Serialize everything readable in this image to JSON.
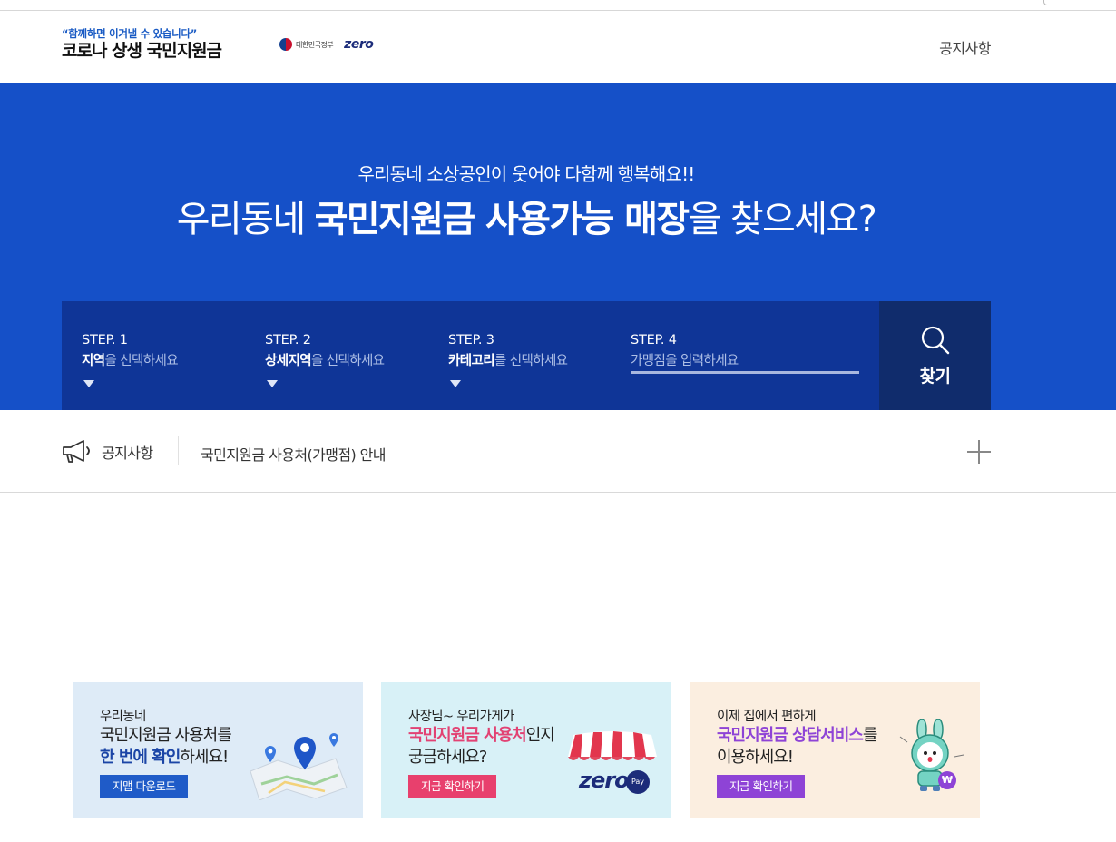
{
  "header": {
    "slogan": "“함께하면 이겨낼 수 있습니다”",
    "brand": "코로나 상생 국민지원금",
    "gov_name": "대한민국정부",
    "zero_logo": "zero",
    "notice_link": "공지사항"
  },
  "hero": {
    "subtitle": "우리동네 소상공인이 웃어야 다함께 행복해요!!",
    "title_pre": "우리동네 ",
    "title_bold": "국민지원금 사용가능 매장",
    "title_post": "을 찾으세요?",
    "accent_color": "#1550c8"
  },
  "search": {
    "steps": [
      {
        "no": "STEP. 1",
        "bold": "지역",
        "rest": "을 선택하세요"
      },
      {
        "no": "STEP. 2",
        "bold": "상세지역",
        "rest": "을 선택하세요"
      },
      {
        "no": "STEP. 3",
        "bold": "카테고리",
        "rest": "를 선택하세요"
      },
      {
        "no": "STEP. 4",
        "placeholder": "가맹점을 입력하세요"
      }
    ],
    "search_label": "찾기"
  },
  "notice": {
    "label": "공지사항",
    "text": "국민지원금 사용처(가맹점) 안내"
  },
  "banners": [
    {
      "line1": "우리동네",
      "line2": "국민지원금 사용처를",
      "line3_bold": "한 번에 확인",
      "line3_rest": "하세요!",
      "button": "지맵 다운로드"
    },
    {
      "line1": "사장님~ 우리가게가",
      "line2_bold": "국민지원금 사용처",
      "line2_rest": "인지",
      "line3": "궁금하세요?",
      "button": "지금 확인하기",
      "zero_logo": "zero",
      "pay_text": "Pay"
    },
    {
      "line1": "이제 집에서 편하게",
      "line2_bold": "국민지원금 상담서비스",
      "line2_rest": "를",
      "line3": "이용하세요!",
      "button": "지금 확인하기",
      "coin_symbol": "₩"
    }
  ]
}
